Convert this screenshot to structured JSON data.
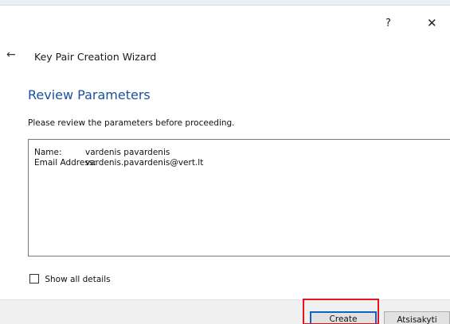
{
  "titlebar": {
    "help_label": "?",
    "close_label": "✕"
  },
  "header": {
    "back_label": "←",
    "wizard_title": "Key Pair Creation Wizard"
  },
  "main": {
    "heading": "Review Parameters",
    "instruction": "Please review the parameters before proceeding.",
    "params": [
      {
        "label": "Name:",
        "value": "vardenis pavardenis"
      },
      {
        "label": "Email Address:",
        "value": "vardenis.pavardenis@vert.lt"
      }
    ],
    "show_details_label": "Show all details",
    "show_details_checked": false
  },
  "footer": {
    "create_label": "Create",
    "cancel_label": "Atsisakyti"
  },
  "colors": {
    "heading": "#1c4f9c",
    "highlight": "#e3141b",
    "focus_border": "#0a64c8"
  }
}
